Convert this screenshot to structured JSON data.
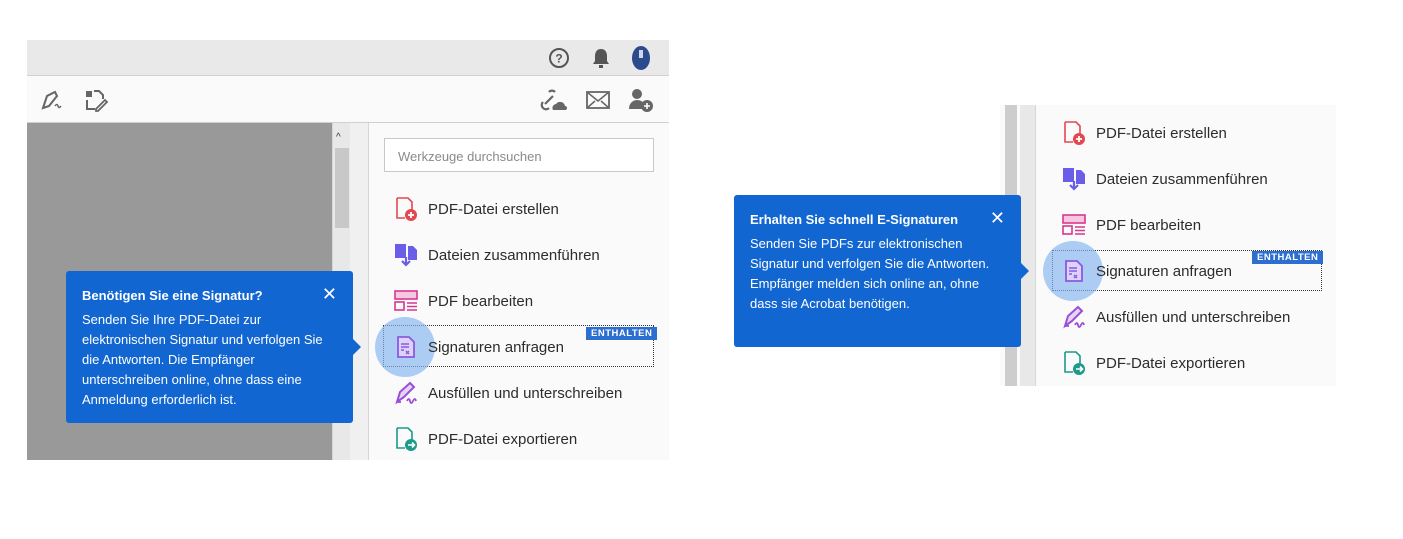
{
  "header": {
    "icons": [
      "help-icon",
      "bell-icon",
      "avatar"
    ]
  },
  "toolbar": {
    "left_icons": [
      "fill-sign-icon",
      "edit-pdf-icon"
    ],
    "right_icons": [
      "share-link-icon",
      "email-icon",
      "add-user-icon"
    ]
  },
  "tools": {
    "search_placeholder": "Werkzeuge durchsuchen",
    "items": [
      {
        "label": "PDF-Datei erstellen",
        "icon": "create-pdf-icon",
        "color": "#e34850"
      },
      {
        "label": "Dateien zusammenführen",
        "icon": "combine-files-icon",
        "color": "#6a5ee8"
      },
      {
        "label": "PDF bearbeiten",
        "icon": "edit-pdf-icon",
        "color": "#d83790"
      },
      {
        "label": "Signaturen anfragen",
        "icon": "request-signature-icon",
        "color": "#8a5be0"
      },
      {
        "label": "Ausfüllen und unterschreiben",
        "icon": "fill-sign-icon",
        "color": "#9b4fd6"
      },
      {
        "label": "PDF-Datei exportieren",
        "icon": "export-pdf-icon",
        "color": "#1c9a8a"
      }
    ],
    "badge": "ENTHALTEN"
  },
  "tooltip1": {
    "title": "Benötigen Sie eine Signatur?",
    "body": "Senden Sie Ihre PDF-Datei zur elektronischen Signatur und verfolgen Sie die Antworten. Die Empfänger unterschreiben online, ohne dass eine Anmeldung erforderlich ist.",
    "close": "✕"
  },
  "tooltip2": {
    "title": "Erhalten Sie schnell E-Signaturen",
    "body": "Senden Sie PDFs zur elektronischen Signatur und verfolgen Sie die Antworten. Empfänger melden sich online an, ohne dass sie Acrobat benötigen.",
    "close": "✕"
  },
  "colors": {
    "accent": "#1166d1",
    "badge": "#2d6fd0"
  }
}
